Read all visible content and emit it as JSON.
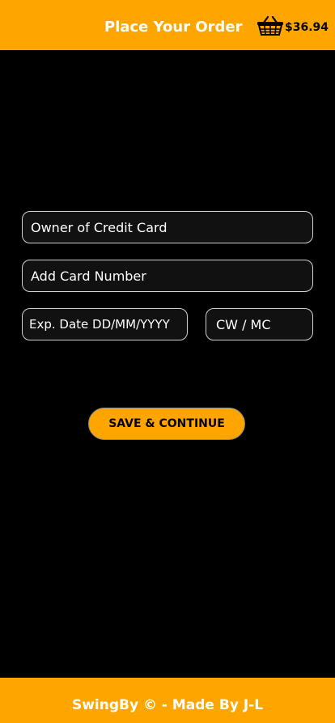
{
  "header": {
    "title": "Place Your Order",
    "cart_total": "$36.94",
    "cart_icon": "basket-icon"
  },
  "form": {
    "owner_placeholder": "Owner of Credit Card",
    "card_number_placeholder": "Add Card Number",
    "exp_placeholder": "Exp. Date DD/MM/YYYY",
    "cvv_placeholder": "CW / MC",
    "save_label": "SAVE & CONTINUE"
  },
  "footer": {
    "text": "SwingBy © - Made By J-L"
  },
  "colors": {
    "accent": "#FFA500",
    "background": "#000000",
    "field_background": "#111111",
    "field_border": "#CFCFCF"
  }
}
